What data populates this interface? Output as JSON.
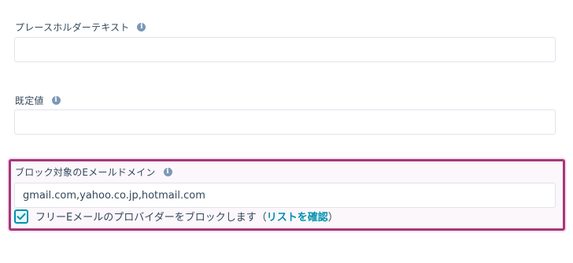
{
  "placeholder_field": {
    "label": "プレースホルダーテキスト",
    "value": ""
  },
  "default_value_field": {
    "label": "既定値",
    "value": ""
  },
  "blocked_domains_field": {
    "label": "ブロック対象のEメールドメイン",
    "value": "gmail.com,yahoo.co.jp,hotmail.com"
  },
  "free_email_checkbox": {
    "checked": true,
    "label": "フリーEメールのプロバイダーをブロックします",
    "paren_open": "（",
    "link_text": "リストを確認",
    "paren_close": "）"
  },
  "icons": {
    "info": "info-icon",
    "check": "checkmark-icon"
  },
  "colors": {
    "highlight_border": "#a6387a",
    "link": "#0091ae",
    "info_icon": "#7c98b6",
    "text": "#33475b"
  }
}
